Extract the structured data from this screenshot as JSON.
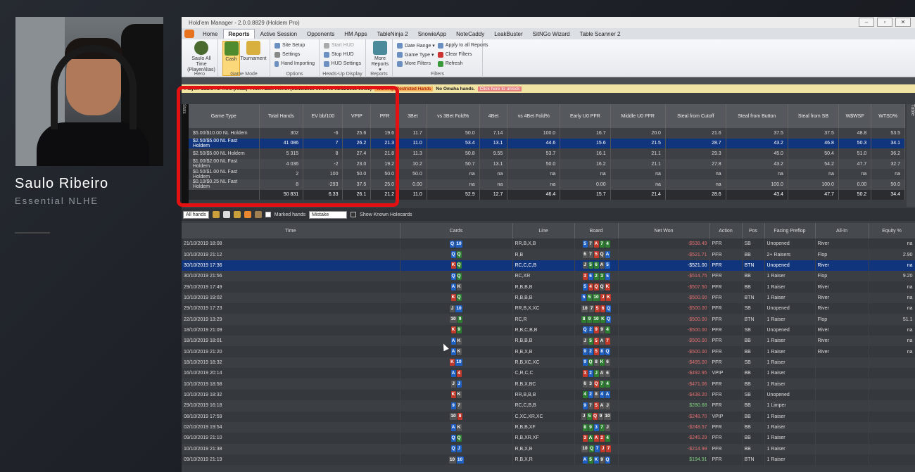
{
  "presenter": {
    "name": "Saulo Ribeiro",
    "subtitle": "Essential NLHE"
  },
  "app": {
    "title": "Hold'em Manager - 2.0.0.8829 (Holdem Pro)",
    "window_controls": [
      "–",
      "▫",
      "✕"
    ],
    "tabs": [
      "Home",
      "Reports",
      "Active Session",
      "Opponents",
      "HM Apps",
      "TableNinja 2",
      "SnowieApp",
      "NoteCaddy",
      "LeakBuster",
      "SitNGo Wizard",
      "Table Scanner 2"
    ],
    "active_tab": "Reports",
    "ribbon": {
      "hero": {
        "label": "Saulo All Time (PlayerAlias)",
        "group": "Hero"
      },
      "gamemode": {
        "cash": "Cash",
        "tournament": "Tournament",
        "group": "Game Mode"
      },
      "options": {
        "items": [
          "Site Setup",
          "Settings",
          "Hand Importing"
        ],
        "group": "Options"
      },
      "hud": {
        "items": [
          "Start HUD",
          "Stop HUD",
          "HUD Settings"
        ],
        "group": "Heads-Up Display"
      },
      "reports": {
        "label": "More Reports ▾",
        "group": "Reports"
      },
      "filters": {
        "items": [
          "Date Range ▾",
          "Game Type ▾",
          "More Filters"
        ],
        "items2": [
          "Apply to all Reports",
          "Clear Filters",
          "Refresh"
        ],
        "group": "Filters"
      }
    },
    "filterbar": {
      "player": "Player: Saulo All Time (Alias)",
      "filter": "Filter: Last month (01/10/2019 00:00 to 01/11/2019 00:00)",
      "warning": "Warning: Restricted Hands",
      "omaha": "No Omaha hands.",
      "link": "Click here to unlock"
    },
    "side_labels": {
      "left": "Stats",
      "right": "Table"
    },
    "stats": {
      "headers": [
        "Game Type",
        "Total Hands",
        "EV bb/100",
        "VPIP",
        "PFR",
        "3Bet",
        "vs 3Bet Fold%",
        "4Bet",
        "vs 4Bet Fold%",
        "Early U0 PFR",
        "Middle U0 PFR",
        "Steal from Cutoff",
        "Steal from Button",
        "Steal from SB",
        "W$WSF",
        "WTSD%"
      ],
      "rows": [
        [
          "$5.00/$10.00 NL Holdem",
          "302",
          "-6",
          "25.6",
          "19.6",
          "11.7",
          "50.0",
          "7.14",
          "100.0",
          "16.7",
          "20.0",
          "21.6",
          "37.5",
          "37.5",
          "48.8",
          "53.5"
        ],
        [
          "$2.50/$5.00 NL Fast Holdem",
          "41 086",
          "7",
          "26.2",
          "21.3",
          "11.0",
          "53.4",
          "13.1",
          "44.6",
          "15.6",
          "21.5",
          "28.7",
          "43.2",
          "46.8",
          "50.3",
          "34.1"
        ],
        [
          "$2.50/$5.00 NL Holdem",
          "5 315",
          "8",
          "27.4",
          "21.8",
          "11.3",
          "50.8",
          "9.55",
          "53.7",
          "16.1",
          "21.1",
          "29.3",
          "45.0",
          "50.4",
          "51.0",
          "36.2"
        ],
        [
          "$1.00/$2.00 NL Fast Holdem",
          "4 036",
          "-2",
          "23.0",
          "19.2",
          "10.2",
          "50.7",
          "13.1",
          "50.0",
          "16.2",
          "21.1",
          "27.8",
          "43.2",
          "54.2",
          "47.7",
          "32.7"
        ],
        [
          "$0.50/$1.00 NL Fast Holdem",
          "2",
          "100",
          "50.0",
          "50.0",
          "50.0",
          "na",
          "na",
          "na",
          "na",
          "na",
          "na",
          "na",
          "na",
          "na",
          "na"
        ],
        [
          "$0.10/$0.25 NL Fast Holdem",
          "8",
          "-293",
          "37.5",
          "25.0",
          "0.00",
          "na",
          "na",
          "na",
          "0.00",
          "na",
          "na",
          "100.0",
          "100.0",
          "0.00",
          "50.0"
        ],
        [
          "",
          "50 831",
          "6.33",
          "26.1",
          "21.2",
          "11.0",
          "52.9",
          "12.7",
          "46.4",
          "15.7",
          "21.4",
          "28.6",
          "43.4",
          "47.7",
          "50.2",
          "34.4"
        ]
      ],
      "selected_row": 1
    },
    "toolbar": {
      "filter": "All hands",
      "marked": "Marked hands",
      "mistake": "Mistake",
      "holecards": "Show Known Holecards"
    },
    "hands": {
      "headers": [
        "Time",
        "Cards",
        "Line",
        "Board",
        "Net Won",
        "Action",
        "Pos",
        "Facing Preflop",
        "All-In",
        "Equity %"
      ],
      "rows": [
        [
          "21/10/2019 18:08",
          [
            "Q",
            "10"
          ],
          "RR,B,X,B",
          [
            "5",
            "7",
            "A",
            "7",
            "4"
          ],
          "-$538.49",
          "PFR",
          "SB",
          "Unopened",
          "River",
          "na"
        ],
        [
          "10/10/2019 21:12",
          [
            "Q",
            "Q"
          ],
          "R,B",
          [
            "6",
            "7",
            "5",
            "Q",
            "A"
          ],
          "-$521.71",
          "PFR",
          "BB",
          "2+ Raisers",
          "Flop",
          "2.90"
        ],
        [
          "30/10/2019 17:36",
          [
            "K",
            "Q"
          ],
          "RC,C,C,B",
          [
            "J",
            "5",
            "6",
            "A",
            "5"
          ],
          "-$521.00",
          "PFR",
          "BTN",
          "Unopened",
          "River",
          "na"
        ],
        [
          "30/10/2019 21:56",
          [
            "Q",
            "Q"
          ],
          "RC,XR",
          [
            "3",
            "6",
            "2",
            "3",
            "5"
          ],
          "-$514.75",
          "PFR",
          "BB",
          "1 Raiser",
          "Flop",
          "9.20"
        ],
        [
          "29/10/2019 17:49",
          [
            "A",
            "K"
          ],
          "R,B,B,B",
          [
            "5",
            "4",
            "Q",
            "Q",
            "K"
          ],
          "-$507.50",
          "PFR",
          "BB",
          "1 Raiser",
          "River",
          "na"
        ],
        [
          "10/10/2019 19:02",
          [
            "K",
            "Q"
          ],
          "R,B,B,B",
          [
            "5",
            "5",
            "10",
            "J",
            "K"
          ],
          "-$500.00",
          "PFR",
          "BTN",
          "1 Raiser",
          "River",
          "na"
        ],
        [
          "29/10/2019 17:23",
          [
            "J",
            "10"
          ],
          "RR,B,X,XC",
          [
            "10",
            "7",
            "5",
            "6",
            "Q"
          ],
          "-$500.00",
          "PFR",
          "SB",
          "Unopened",
          "River",
          "na"
        ],
        [
          "22/10/2019 13:29",
          [
            "10",
            "9"
          ],
          "RC,R",
          [
            "8",
            "9",
            "10",
            "K",
            "Q"
          ],
          "-$500.00",
          "PFR",
          "BTN",
          "1 Raiser",
          "Flop",
          "51.1"
        ],
        [
          "18/10/2019 21:09",
          [
            "K",
            "9"
          ],
          "R,B,C,B,B",
          [
            "Q",
            "2",
            "9",
            "9",
            "4"
          ],
          "-$500.00",
          "PFR",
          "SB",
          "Unopened",
          "River",
          "na"
        ],
        [
          "18/10/2019 18:01",
          [
            "A",
            "K"
          ],
          "R,B,B,B",
          [
            "J",
            "5",
            "5",
            "A",
            "7"
          ],
          "-$500.00",
          "PFR",
          "BB",
          "1 Raiser",
          "River",
          "na"
        ],
        [
          "10/10/2019 21:20",
          [
            "A",
            "K"
          ],
          "R,B,X,B",
          [
            "9",
            "2",
            "5",
            "8",
            "Q"
          ],
          "-$500.00",
          "PFR",
          "BB",
          "1 Raiser",
          "River",
          "na"
        ],
        [
          "18/10/2019 18:32",
          [
            "K",
            "10"
          ],
          "R,B,XC,XC",
          [
            "9",
            "Q",
            "8",
            "K",
            "6"
          ],
          "-$495.00",
          "PFR",
          "SB",
          "1 Raiser",
          "",
          ""
        ],
        [
          "16/10/2019 20:14",
          [
            "A",
            "4"
          ],
          "C,R,C,C",
          [
            "3",
            "2",
            "J",
            "A",
            "6"
          ],
          "-$492.95",
          "VPIP",
          "BB",
          "1 Raiser",
          "",
          ""
        ],
        [
          "10/10/2019 18:58",
          [
            "J",
            "J"
          ],
          "R,B,X,BC",
          [
            "6",
            "3",
            "Q",
            "7",
            "4"
          ],
          "-$471.06",
          "PFR",
          "BB",
          "1 Raiser",
          "",
          ""
        ],
        [
          "10/10/2019 18:32",
          [
            "K",
            "K"
          ],
          "RR,B,B,B",
          [
            "4",
            "2",
            "8",
            "4",
            "A"
          ],
          "-$438.20",
          "PFR",
          "SB",
          "Unopened",
          "",
          ""
        ],
        [
          "29/10/2019 16:18",
          [
            "9",
            "7"
          ],
          "RC,C,B,B",
          [
            "9",
            "7",
            "5",
            "A",
            "J"
          ],
          "$280.68",
          "PFR",
          "BB",
          "1 Limper",
          "",
          ""
        ],
        [
          "08/10/2019 17:59",
          [
            "10",
            "8"
          ],
          "C,XC,XR,XC",
          [
            "J",
            "5",
            "Q",
            "9",
            "10"
          ],
          "-$248.70",
          "VPIP",
          "BB",
          "1 Raiser",
          "",
          ""
        ],
        [
          "02/10/2019 19:54",
          [
            "A",
            "K"
          ],
          "R,B,B,XF",
          [
            "8",
            "9",
            "3",
            "7",
            "J"
          ],
          "-$248.57",
          "PFR",
          "BB",
          "1 Raiser",
          "",
          ""
        ],
        [
          "09/10/2019 21:10",
          [
            "Q",
            "Q"
          ],
          "R,B,XR,XF",
          [
            "3",
            "A",
            "A",
            "2",
            "4"
          ],
          "-$245.29",
          "PFR",
          "BB",
          "1 Raiser",
          "",
          ""
        ],
        [
          "10/10/2019 21:38",
          [
            "Q",
            "J"
          ],
          "R,B,X,B",
          [
            "10",
            "Q",
            "7",
            "J",
            "7"
          ],
          "-$214.99",
          "PFR",
          "BB",
          "1 Raiser",
          "",
          ""
        ],
        [
          "09/10/2019 21:19",
          [
            "10",
            "10"
          ],
          "R,B,X,R",
          [
            "A",
            "5",
            "K",
            "9",
            "Q"
          ],
          "$194.91",
          "PFR",
          "BTN",
          "1 Raiser",
          "",
          ""
        ]
      ],
      "selected_row": 2
    }
  },
  "colors": {
    "suits": [
      "#c0392b",
      "#2e7d32",
      "#1f5fbf",
      "#555555"
    ],
    "selected": "#10357d",
    "highlight_box": "#e31111"
  }
}
